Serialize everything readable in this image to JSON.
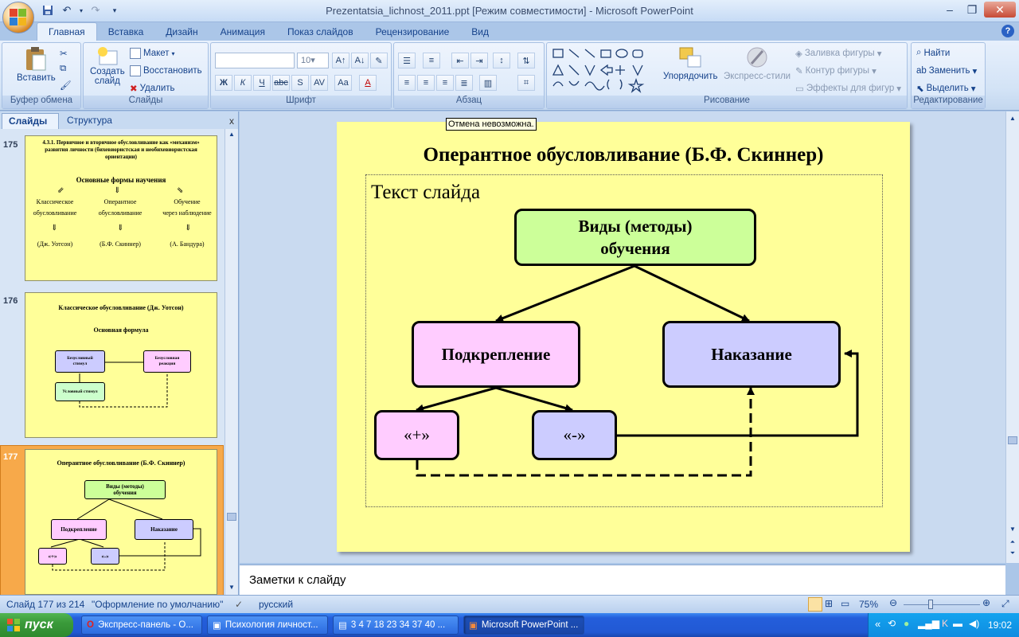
{
  "window": {
    "title": "Prezentatsia_lichnost_2011.ppt [Режим совместимости] - Microsoft PowerPoint"
  },
  "ribbon_tabs": [
    "Главная",
    "Вставка",
    "Дизайн",
    "Анимация",
    "Показ слайдов",
    "Рецензирование",
    "Вид"
  ],
  "clipboard": {
    "paste": "Вставить",
    "label": "Буфер обмена"
  },
  "slides_group": {
    "create": "Создать",
    "create2": "слайд",
    "layout": "Макет",
    "reset": "Восстановить",
    "delete": "Удалить",
    "label": "Слайды"
  },
  "font_group": {
    "font_size": "10",
    "label": "Шрифт"
  },
  "paragraph_group": {
    "label": "Абзац"
  },
  "drawing_group": {
    "arrange": "Упорядочить",
    "quick_styles": "Экспресс-стили",
    "fill": "Заливка фигуры",
    "outline": "Контур фигуры",
    "effects": "Эффекты для фигур",
    "label": "Рисование"
  },
  "editing_group": {
    "find": "Найти",
    "replace": "Заменить",
    "select": "Выделить",
    "label": "Редактирование"
  },
  "left_panel": {
    "tab_slides": "Слайды",
    "tab_outline": "Структура",
    "close": "x",
    "thumbs": [
      {
        "num": "175",
        "title_line1": "4.3.1. Первичное и вторичное обусловливание как «механизм»",
        "title_line2": "развития личности (бихевиористская и необихевиористская",
        "title_line3": "ориентации)",
        "heading": "Основные формы научения",
        "col1a": "Классическое",
        "col1b": "обусловливание",
        "col1c": "(Дж. Уотсон)",
        "col2a": "Оперантное",
        "col2b": "обусловливание",
        "col2c": "(Б.Ф. Скиннер)",
        "col3a": "Обучение",
        "col3b": "через наблюдение",
        "col3c": "(А. Бандура)"
      },
      {
        "num": "176",
        "title": "Классическое  обусловливание (Дж. Уотсон)",
        "heading": "Основная формула",
        "box1a": "Безусловный",
        "box1b": "стимул",
        "box2a": "Безусловная",
        "box2b": "реакция",
        "box3": "Условный стимул"
      },
      {
        "num": "177",
        "title": "Оперантное обусловливание (Б.Ф. Скиннер)",
        "root1": "Виды (методы)",
        "root2": "обучения",
        "left": "Подкрепление",
        "right": "Наказание",
        "plus": "«+»",
        "minus": "«-»"
      }
    ]
  },
  "slide": {
    "tooltip": "Отмена невозможна.",
    "title": "Оперантное обусловливание (Б.Ф. Скиннер)",
    "placeholder": "Текст слайда",
    "root_line1": "Виды (методы)",
    "root_line2": "обучения",
    "reinforcement": "Подкрепление",
    "punishment": "Наказание",
    "plus": "«+»",
    "minus": "«-»",
    "colors": {
      "root": "#ccff99",
      "reinforcement": "#ffccff",
      "punishment": "#ccccff",
      "plus": "#ffccff",
      "minus": "#ccccff",
      "background": "#ffff99"
    }
  },
  "notes": {
    "placeholder": "Заметки к слайду"
  },
  "status": {
    "slide": "Слайд 177 из 214",
    "theme": "\"Оформление по умолчанию\"",
    "language": "русский",
    "zoom": "75%"
  },
  "taskbar": {
    "start": "пуск",
    "tasks": [
      "Экспресс-панель - О...",
      "Психология личност...",
      "3 4 7 18 23 34 37 40 ...",
      "Microsoft PowerPoint ..."
    ],
    "lang": "RU",
    "clock": "19:02"
  }
}
